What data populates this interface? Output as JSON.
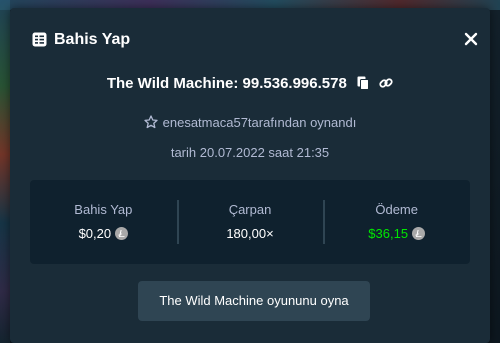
{
  "header": {
    "title": "Bahis Yap",
    "icon": "bet-slip-icon",
    "close_icon": "close-icon"
  },
  "game": {
    "name_and_id": "The Wild Machine: 99.536.996.578",
    "copy_icon": "copy-icon",
    "link_icon": "link-icon"
  },
  "player": {
    "username": "enesatmaca57",
    "suffix": "tarafından oynandı",
    "icon": "star-icon"
  },
  "date": {
    "text": "tarih 20.07.2022 saat 21:35"
  },
  "stats": {
    "bet_label": "Bahis Yap",
    "bet_value": "$0,20",
    "multiplier_label": "Çarpan",
    "multiplier_value": "180,00×",
    "payout_label": "Ödeme",
    "payout_value": "$36,15",
    "currency_icon": "litecoin-icon"
  },
  "play_button": {
    "label": "The Wild Machine oyununu oyna"
  },
  "colors": {
    "modal_bg": "#1a2c38",
    "stats_bg": "#0f212e",
    "button_bg": "#2f4553",
    "muted_text": "#b1bad3",
    "win_green": "#00e701"
  }
}
